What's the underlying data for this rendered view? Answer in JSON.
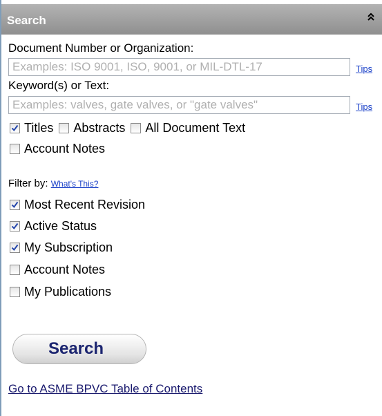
{
  "panel": {
    "title": "Search",
    "collapse_icon": "double-chevron-up-icon"
  },
  "doc_number": {
    "label": "Document Number or Organization:",
    "placeholder": "Examples: ISO 9001, ISO, 9001, or MIL-DTL-17",
    "value": "",
    "tips_label": "Tips"
  },
  "keywords": {
    "label": "Keyword(s) or Text:",
    "placeholder": "Examples: valves, gate valves, or \"gate valves\"",
    "value": "",
    "tips_label": "Tips"
  },
  "scope_options": [
    {
      "label": "Titles",
      "checked": true
    },
    {
      "label": "Abstracts",
      "checked": false
    },
    {
      "label": "All Document Text",
      "checked": false
    },
    {
      "label": "Account Notes",
      "checked": false
    }
  ],
  "filter": {
    "label": "Filter by:",
    "whats_this": "What's This?",
    "options": [
      {
        "label": "Most Recent Revision",
        "checked": true
      },
      {
        "label": "Active Status",
        "checked": true
      },
      {
        "label": "My Subscription",
        "checked": true
      },
      {
        "label": "Account Notes",
        "checked": false
      },
      {
        "label": "My Publications",
        "checked": false
      }
    ]
  },
  "search_button": {
    "label": "Search"
  },
  "toc_link": {
    "label": "Go to ASME BPVC Table of Contents"
  },
  "colors": {
    "header_bg": "#999999",
    "link": "#1a40c8",
    "button_text": "#1c2570",
    "checkmark": "#2244aa"
  }
}
